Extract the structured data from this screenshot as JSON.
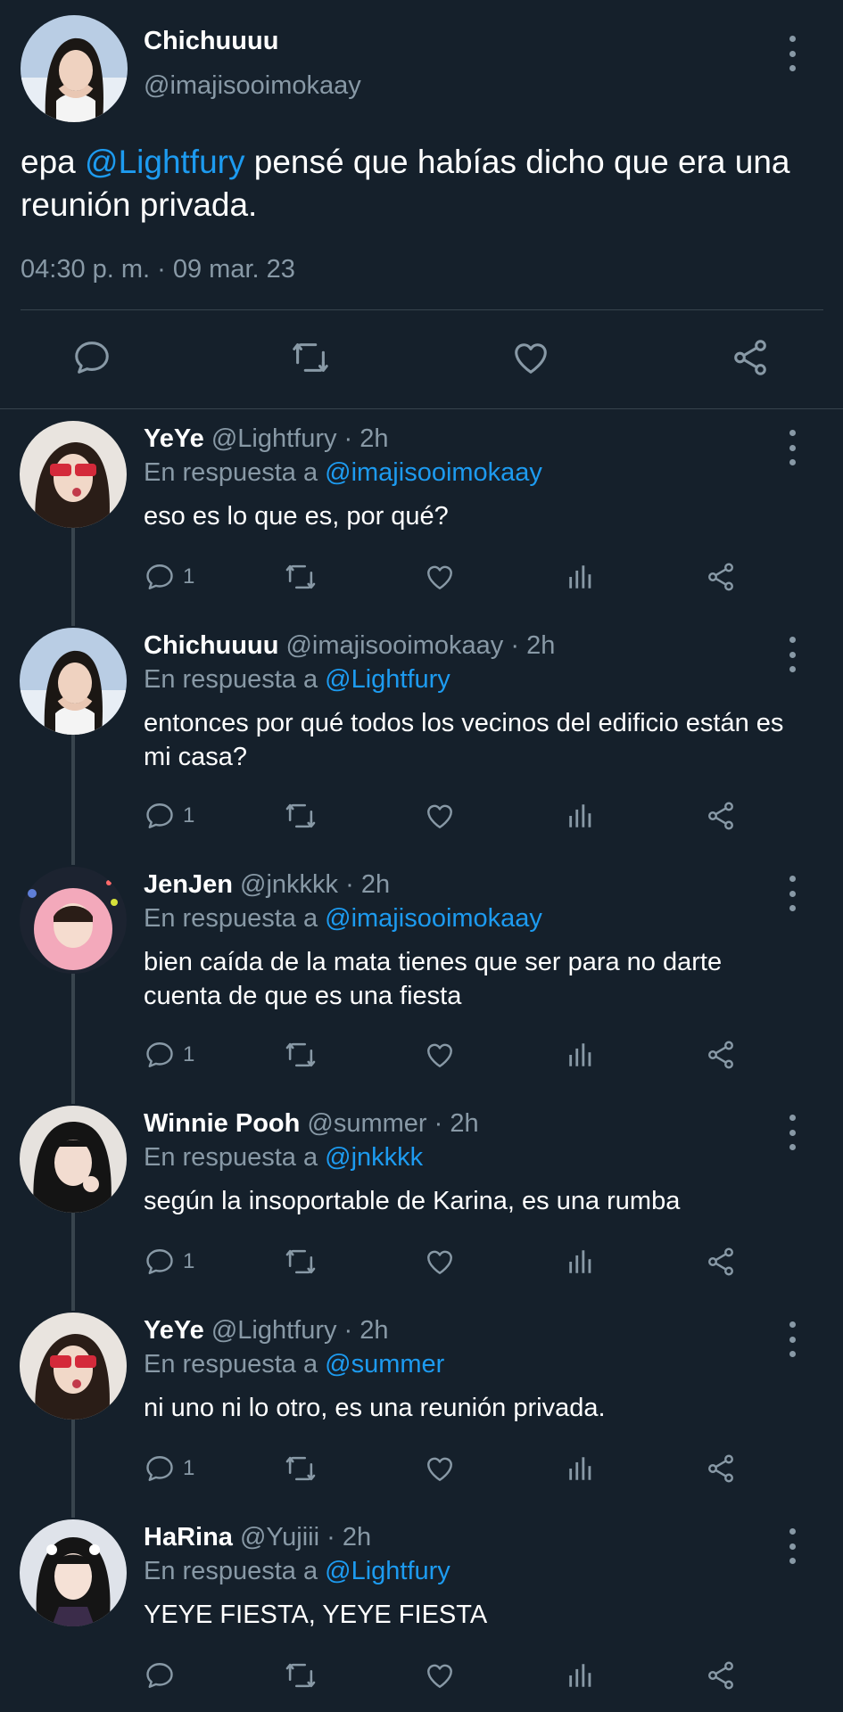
{
  "colors": {
    "background": "#15202b",
    "divider": "#38444d",
    "secondary_text": "#8899a6",
    "mention": "#1d9bf0"
  },
  "main_tweet": {
    "author_name": "Chichuuuu",
    "author_handle": "@imajisooimokaay",
    "text_before": "epa ",
    "text_mention": "@Lightfury",
    "text_after": " pensé que habías dicho que era una reunión privada.",
    "timestamp": "04:30 p. m. · 09 mar. 23",
    "actions": [
      "reply-icon",
      "retweet-icon",
      "like-icon",
      "share-icon"
    ]
  },
  "replies": [
    {
      "name": "YeYe",
      "handle": "@Lightfury",
      "separator": "·",
      "time": "2h",
      "reply_prefix": "En respuesta a ",
      "reply_to": "@imajisooimokaay",
      "text": "eso es lo que es, por qué?",
      "reply_count": "1",
      "avatar": "yeye"
    },
    {
      "name": "Chichuuuu",
      "handle": "@imajisooimokaay",
      "separator": "·",
      "time": "2h",
      "reply_prefix": "En respuesta a ",
      "reply_to": "@Lightfury",
      "text": "entonces por qué todos los vecinos del edificio están es mi casa?",
      "reply_count": "1",
      "avatar": "chichu"
    },
    {
      "name": "JenJen",
      "handle": "@jnkkkk",
      "separator": "·",
      "time": "2h",
      "reply_prefix": "En respuesta a ",
      "reply_to": "@imajisooimokaay",
      "text": "bien caída de la mata tienes que ser para no darte cuenta de que es una fiesta",
      "reply_count": "1",
      "avatar": "jenjen"
    },
    {
      "name": "Winnie Pooh",
      "handle": "@summer",
      "separator": "·",
      "time": "2h",
      "reply_prefix": "En respuesta a ",
      "reply_to": "@jnkkkk",
      "text": "según la insoportable de Karina, es una rumba",
      "reply_count": "1",
      "avatar": "winnie"
    },
    {
      "name": "YeYe",
      "handle": "@Lightfury",
      "separator": "·",
      "time": "2h",
      "reply_prefix": "En respuesta a ",
      "reply_to": "@summer",
      "text": "ni uno ni lo otro, es una reunión privada.",
      "reply_count": "1",
      "avatar": "yeye"
    },
    {
      "name": "HaRina",
      "handle": "@Yujiii",
      "separator": "·",
      "time": "2h",
      "reply_prefix": "En respuesta a ",
      "reply_to": "@Lightfury",
      "text": "YEYE FIESTA, YEYE FIESTA",
      "reply_count": "",
      "avatar": "harina"
    }
  ]
}
